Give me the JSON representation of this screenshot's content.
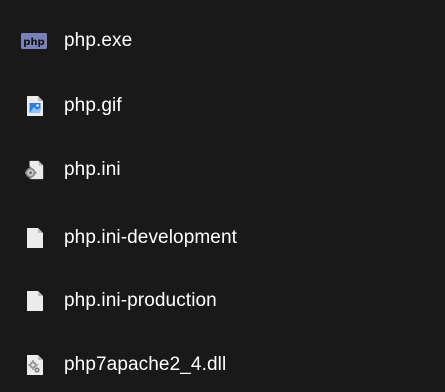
{
  "files": [
    {
      "name": "php.exe",
      "icon": "php-exe-icon"
    },
    {
      "name": "php.gif",
      "icon": "image-file-icon"
    },
    {
      "name": "php.ini",
      "icon": "settings-file-icon"
    },
    {
      "name": "php.ini-development",
      "icon": "blank-file-icon"
    },
    {
      "name": "php.ini-production",
      "icon": "blank-file-icon"
    },
    {
      "name": "php7apache2_4.dll",
      "icon": "dll-file-icon"
    }
  ],
  "colors": {
    "background": "#191919",
    "text": "#ffffff",
    "php_icon_bg": "#7a80b8",
    "image_icon_blue": "#2f7fd8",
    "file_white": "#ececec"
  }
}
